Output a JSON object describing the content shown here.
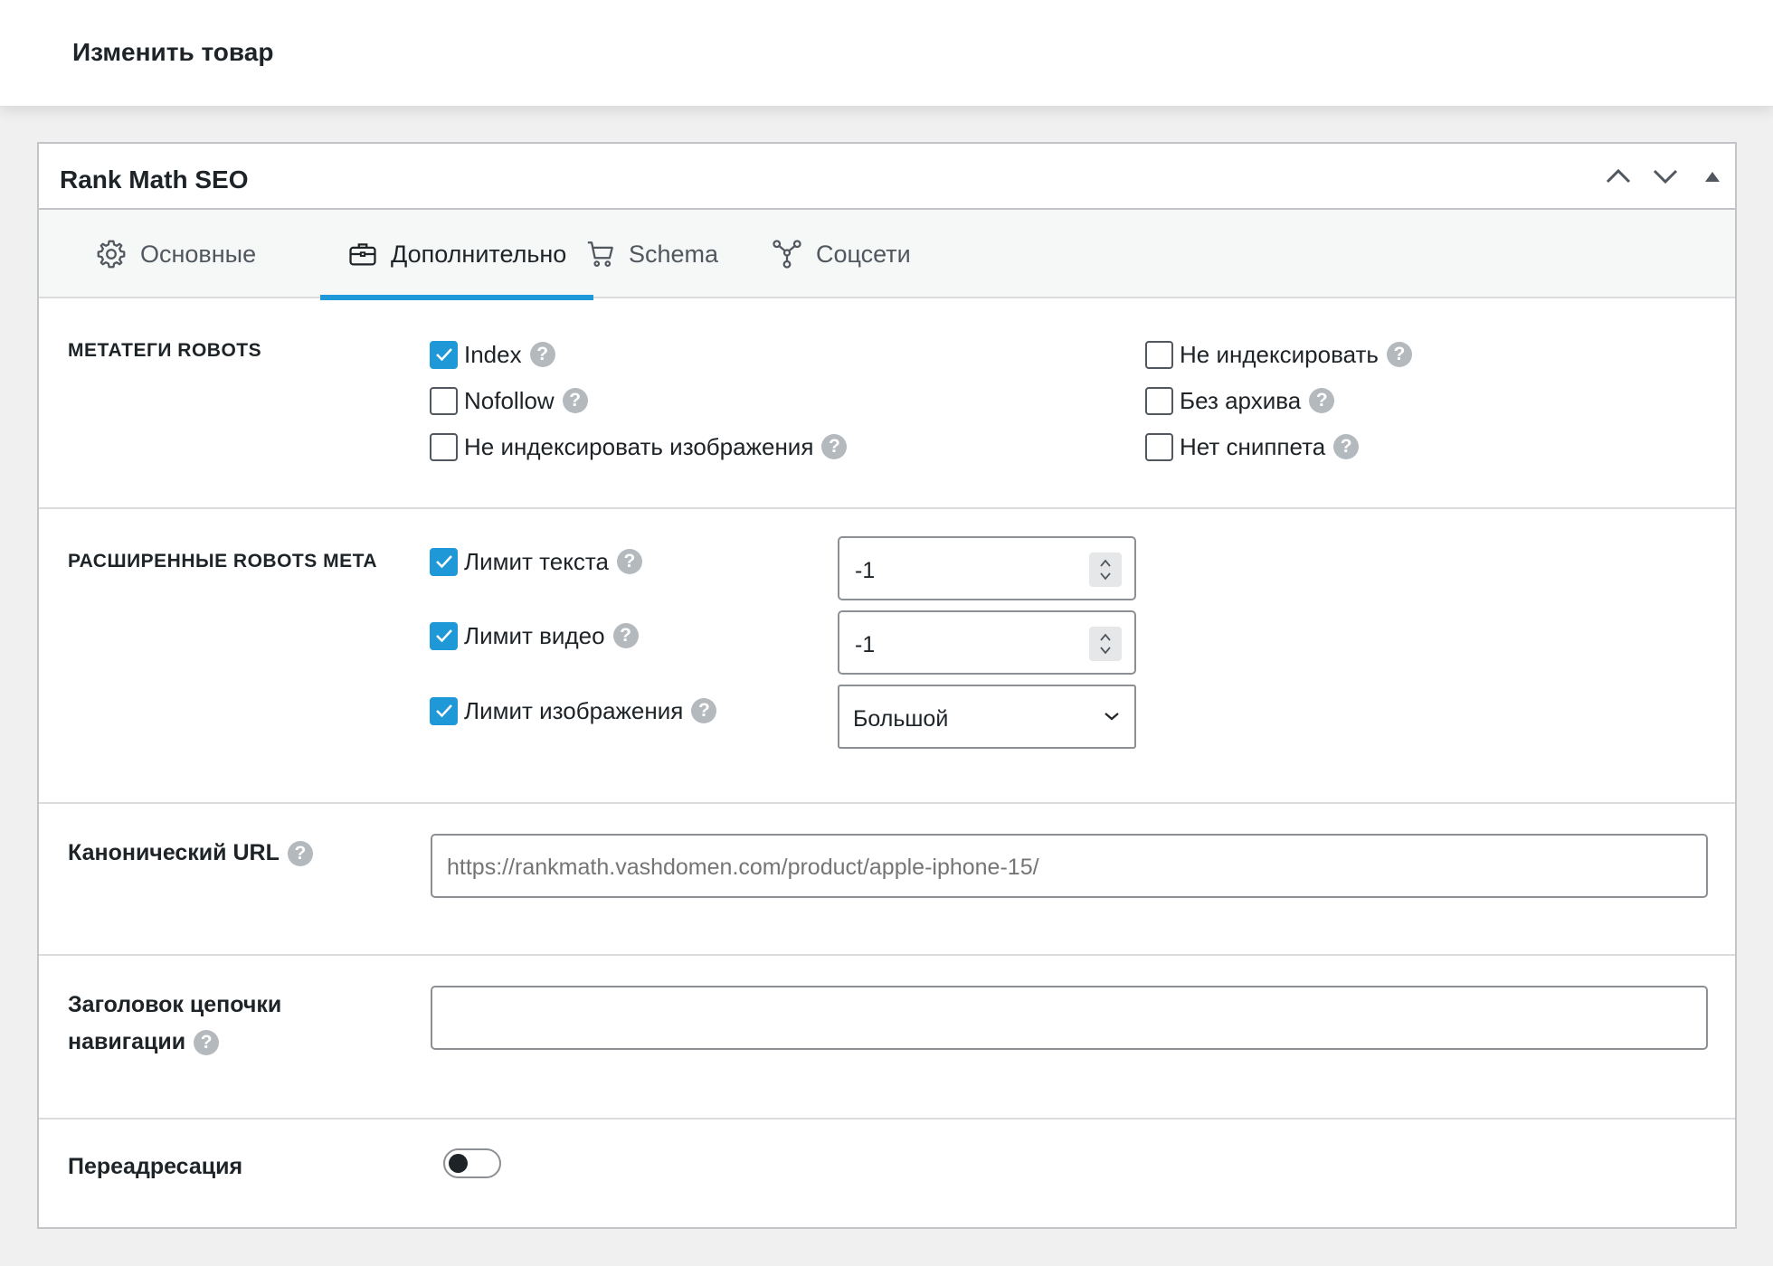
{
  "page": {
    "title": "Изменить товар"
  },
  "panel": {
    "title": "Rank Math SEO",
    "tabs": [
      {
        "label": "Основные",
        "icon": "gear-icon",
        "active": false
      },
      {
        "label": "Дополнительно",
        "icon": "briefcase-icon",
        "active": true
      },
      {
        "label": "Schema",
        "icon": "cart-icon",
        "active": false
      },
      {
        "label": "Соцсети",
        "icon": "share-icon",
        "active": false
      }
    ]
  },
  "robots_meta": {
    "label": "МЕТАТЕГИ ROBOTS",
    "options": [
      {
        "label": "Index",
        "checked": true
      },
      {
        "label": "Nofollow",
        "checked": false
      },
      {
        "label": "Не индексировать изображения",
        "checked": false
      },
      {
        "label": "Не индексировать",
        "checked": false
      },
      {
        "label": "Без архива",
        "checked": false
      },
      {
        "label": "Нет сниппета",
        "checked": false
      }
    ]
  },
  "advanced_robots": {
    "label": "РАСШИРЕННЫЕ ROBOTS META",
    "rows": [
      {
        "label": "Лимит текста",
        "checked": true,
        "value": "-1"
      },
      {
        "label": "Лимит видео",
        "checked": true,
        "value": "-1"
      },
      {
        "label": "Лимит изображения",
        "checked": true,
        "value": "Большой"
      }
    ]
  },
  "canonical": {
    "label": "Канонический URL",
    "placeholder": "https://rankmath.vashdomen.com/product/apple-iphone-15/"
  },
  "breadcrumb": {
    "label_line1": "Заголовок цепочки",
    "label_line2": "навигации",
    "value": ""
  },
  "redirect": {
    "label": "Переадресация",
    "enabled": false
  },
  "colors": {
    "accent": "#1f98d8",
    "help": "#b4b9be",
    "border": "#c3c4c7"
  }
}
